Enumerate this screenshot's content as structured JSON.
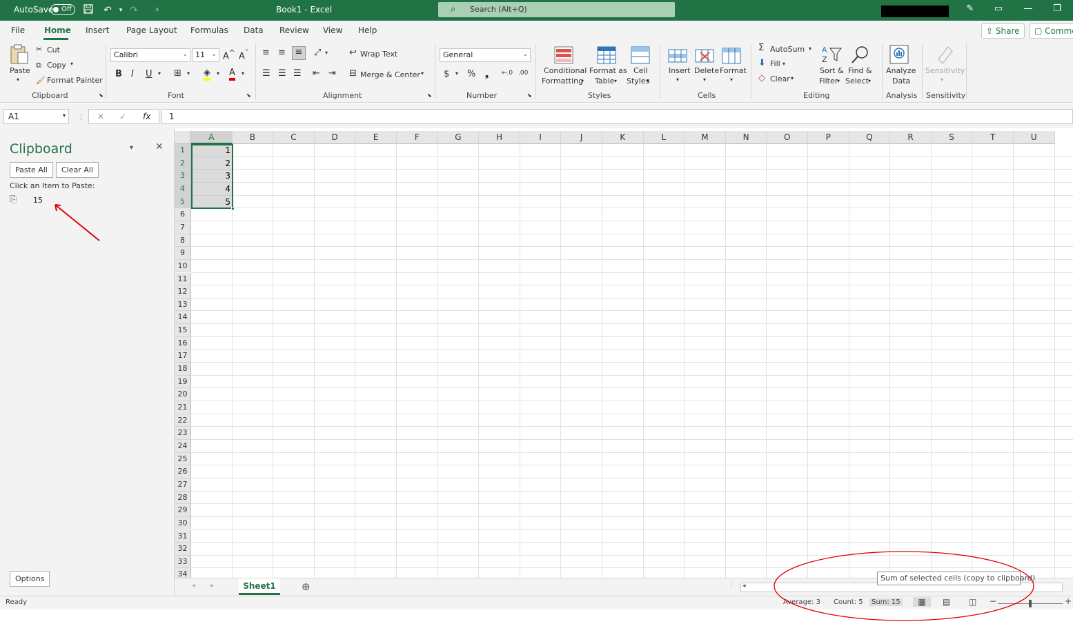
{
  "titlebar": {
    "autosave": "AutoSave",
    "toggle_state": "Off",
    "doc_title": "Book1  -  Excel",
    "search_placeholder": "Search (Alt+Q)"
  },
  "tabs": [
    "File",
    "Home",
    "Insert",
    "Page Layout",
    "Formulas",
    "Data",
    "Review",
    "View",
    "Help"
  ],
  "share_label": "Share",
  "comments_label": "Comme",
  "ribbon": {
    "clipboard": {
      "paste": "Paste",
      "cut": "Cut",
      "copy": "Copy",
      "format_painter": "Format Painter",
      "group": "Clipboard"
    },
    "font": {
      "name": "Calibri",
      "size": "11",
      "group": "Font"
    },
    "alignment": {
      "wrap": "Wrap Text",
      "merge": "Merge & Center",
      "group": "Alignment"
    },
    "number": {
      "format": "General",
      "group": "Number"
    },
    "styles": {
      "cond1": "Conditional",
      "cond2": "Formatting",
      "fmt1": "Format as",
      "fmt2": "Table",
      "cell1": "Cell",
      "cell2": "Styles",
      "group": "Styles"
    },
    "cells": {
      "insert": "Insert",
      "delete": "Delete",
      "format": "Format",
      "group": "Cells"
    },
    "editing": {
      "autosum": "AutoSum",
      "fill": "Fill",
      "clear": "Clear",
      "sort1": "Sort &",
      "sort2": "Filter",
      "find1": "Find &",
      "find2": "Select",
      "group": "Editing"
    },
    "analysis": {
      "a1": "Analyze",
      "a2": "Data",
      "group": "Analysis"
    },
    "sensitivity": {
      "label": "Sensitivity",
      "group": "Sensitivity"
    }
  },
  "formula_bar": {
    "name_box": "A1",
    "fx": "fx",
    "value": "1"
  },
  "clipboard_pane": {
    "title": "Clipboard",
    "paste_all": "Paste All",
    "clear_all": "Clear All",
    "hint": "Click an Item to Paste:",
    "item_value": "15",
    "options": "Options"
  },
  "grid": {
    "columns": [
      "A",
      "B",
      "C",
      "D",
      "E",
      "F",
      "G",
      "H",
      "I",
      "J",
      "K",
      "L",
      "M",
      "N",
      "O",
      "P",
      "Q",
      "R",
      "S",
      "T",
      "U"
    ],
    "rows": [
      "1",
      "2",
      "3",
      "4",
      "5",
      "6",
      "7",
      "8",
      "9",
      "10",
      "11",
      "12",
      "13",
      "14",
      "15",
      "16",
      "17",
      "18",
      "19",
      "20",
      "21",
      "22",
      "23",
      "24",
      "25",
      "26",
      "27",
      "28",
      "29",
      "30",
      "31",
      "32",
      "33",
      "34"
    ],
    "cells_a": [
      "1",
      "2",
      "3",
      "4",
      "5"
    ]
  },
  "sheet_tab": "Sheet1",
  "status": {
    "ready": "Ready",
    "average": "Average: 3",
    "count": "Count: 5",
    "sum": "Sum: 15",
    "tooltip": "Sum of selected cells (copy to clipboard)"
  },
  "colors": {
    "accent": "#217346",
    "annotation": "#e00000"
  }
}
